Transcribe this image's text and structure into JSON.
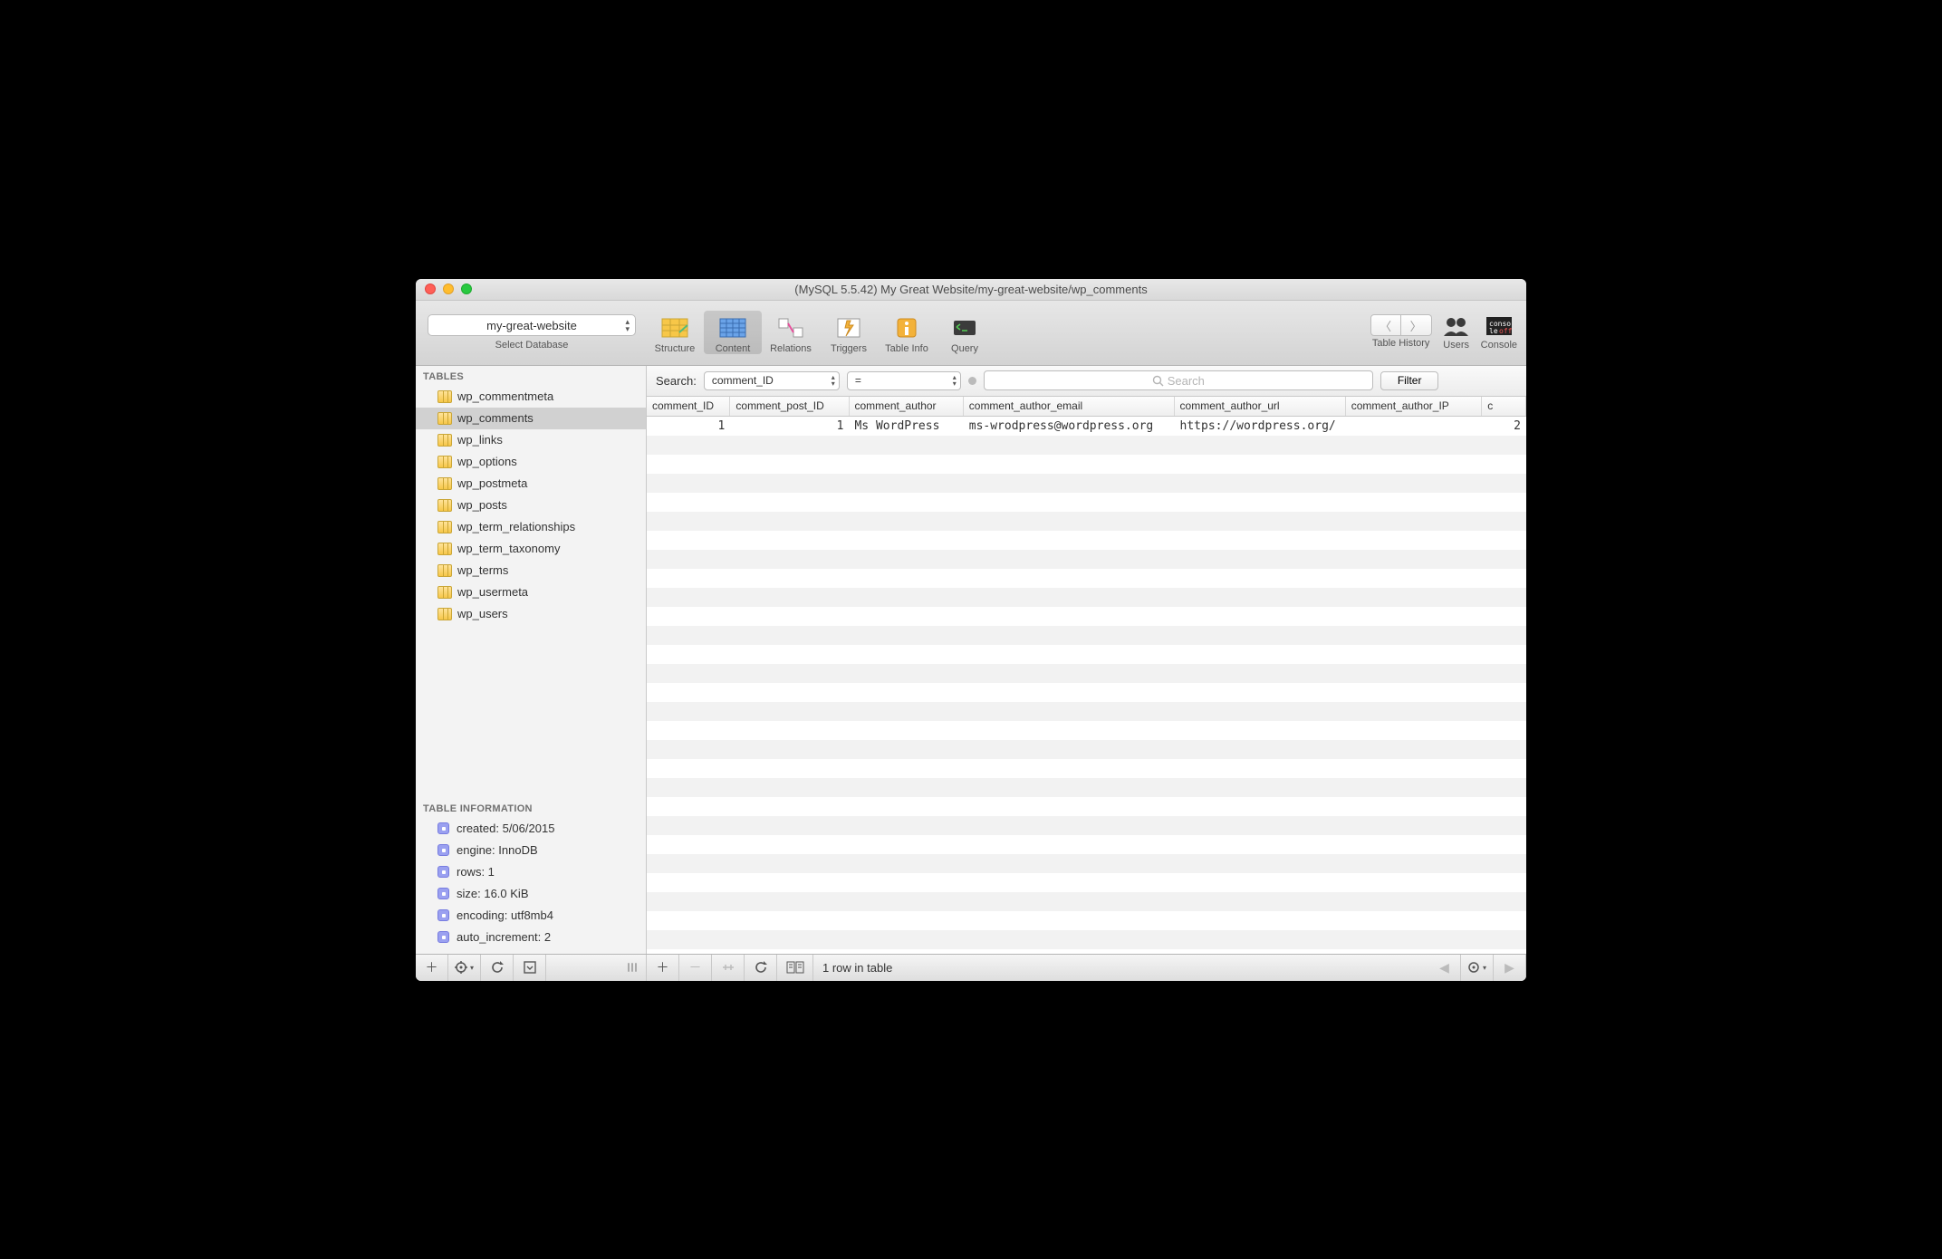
{
  "window": {
    "title": "(MySQL 5.5.42) My Great Website/my-great-website/wp_comments"
  },
  "toolbar": {
    "db_selector": "my-great-website",
    "db_label": "Select Database",
    "items": [
      "Structure",
      "Content",
      "Relations",
      "Triggers",
      "Table Info",
      "Query"
    ],
    "active_index": 1,
    "right": {
      "table_history": "Table History",
      "users": "Users",
      "console": "Console"
    }
  },
  "sidebar": {
    "tables_header": "TABLES",
    "tables": [
      "wp_commentmeta",
      "wp_comments",
      "wp_links",
      "wp_options",
      "wp_postmeta",
      "wp_posts",
      "wp_term_relationships",
      "wp_term_taxonomy",
      "wp_terms",
      "wp_usermeta",
      "wp_users"
    ],
    "selected_index": 1,
    "info_header": "TABLE INFORMATION",
    "info": [
      "created: 5/06/2015",
      "engine: InnoDB",
      "rows: 1",
      "size: 16.0 KiB",
      "encoding: utf8mb4",
      "auto_increment: 2"
    ]
  },
  "searchbar": {
    "label": "Search:",
    "column": "comment_ID",
    "op": "=",
    "placeholder": "Search",
    "filter": "Filter"
  },
  "grid": {
    "columns": [
      "comment_ID",
      "comment_post_ID",
      "comment_author",
      "comment_author_email",
      "comment_author_url",
      "comment_author_IP",
      "c"
    ],
    "rows": [
      {
        "comment_ID": "1",
        "comment_post_ID": "1",
        "comment_author": "Ms WordPress",
        "comment_author_email": "ms-wrodpress@wordpress.org",
        "comment_author_url": "https://wordpress.org/",
        "comment_author_IP": "",
        "c": "2"
      }
    ]
  },
  "bottom": {
    "status": "1 row in table"
  }
}
